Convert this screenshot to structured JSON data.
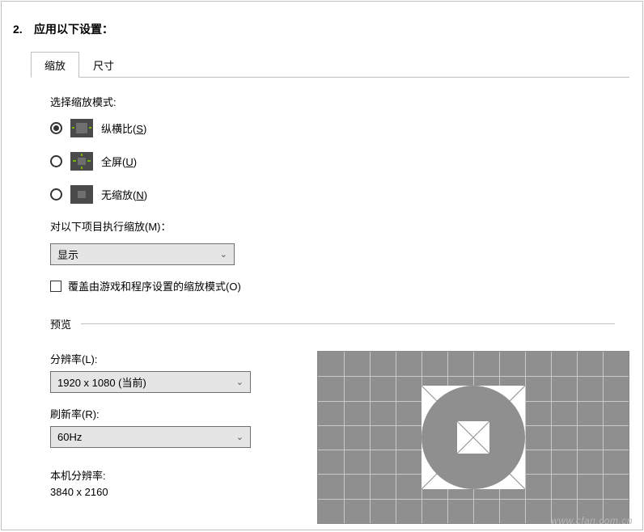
{
  "heading": {
    "num": "2.",
    "text": "应用以下设置："
  },
  "tabs": {
    "scale": "缩放",
    "size": "尺寸"
  },
  "scaling": {
    "mode_label": "选择缩放模式:",
    "aspect": "纵横比(",
    "aspect_k": "S",
    "aspect_end": ")",
    "fullscreen": "全屏(",
    "fullscreen_k": "U",
    "fullscreen_end": ")",
    "noscale": "无缩放(",
    "noscale_k": "N",
    "noscale_end": ")",
    "perform_label": "对以下项目执行缩放(M)：",
    "perform_value": "显示",
    "override_label": "覆盖由游戏和程序设置的缩放模式(O)"
  },
  "preview": {
    "header": "预览",
    "res_label": "分辨率(L):",
    "res_value": "1920 x 1080  (当前)",
    "refresh_label": "刷新率(R):",
    "refresh_value": "60Hz",
    "native_label": "本机分辨率:",
    "native_value": "3840 x 2160"
  },
  "watermark": "www.cfan.com.cn"
}
